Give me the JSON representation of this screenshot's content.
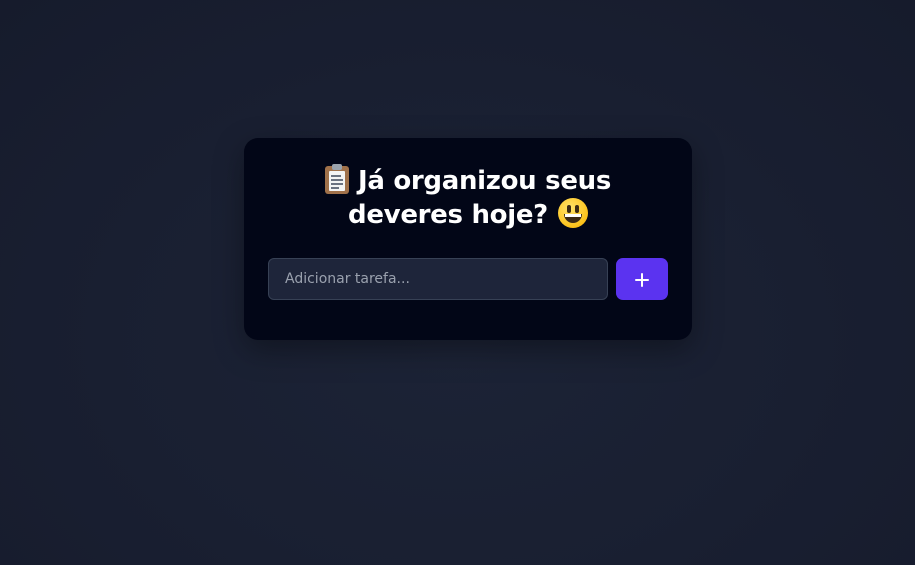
{
  "card": {
    "title_line1": "Já organizou seus",
    "title_line2": "deveres hoje?",
    "title_icon_start": "clipboard-icon",
    "title_icon_end": "grinning-face-icon"
  },
  "form": {
    "input_value": "",
    "input_placeholder": "Adicionar tarefa...",
    "add_button_label": "+",
    "add_button_icon": "plus-icon"
  },
  "colors": {
    "page_background": "#191f31",
    "card_background": "#020617",
    "input_background": "#1e253a",
    "input_border": "#374155",
    "accent": "#5b33f0",
    "text": "#ffffff",
    "placeholder": "#9aa1ae"
  }
}
